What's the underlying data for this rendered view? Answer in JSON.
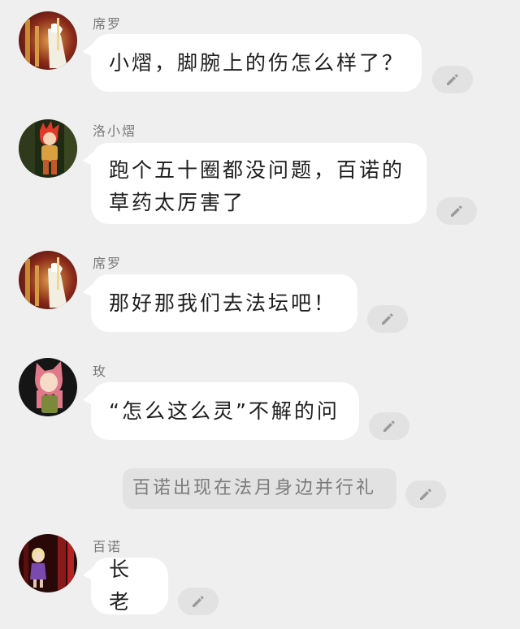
{
  "messages": [
    {
      "speaker": "席罗",
      "text": "小熠，脚腕上的伤怎么样了？"
    },
    {
      "speaker": "洛小熠",
      "text_line1": "跑个五十圈都没问题，百诺的",
      "text_line2": "草药太厉害了"
    },
    {
      "speaker": "席罗",
      "text": "那好那我们去法坛吧！"
    },
    {
      "speaker": "玫",
      "text": "“怎么这么灵”不解的问"
    },
    {
      "narration": "百诺出现在法月身边并行礼"
    },
    {
      "speaker": "百诺",
      "text": "长老"
    }
  ],
  "icons": {
    "edit": "pencil-icon"
  },
  "colors": {
    "background": "#efefef",
    "bubble": "#ffffff",
    "edit_button": "#e2e2e2",
    "icon": "#9a9a9a"
  }
}
